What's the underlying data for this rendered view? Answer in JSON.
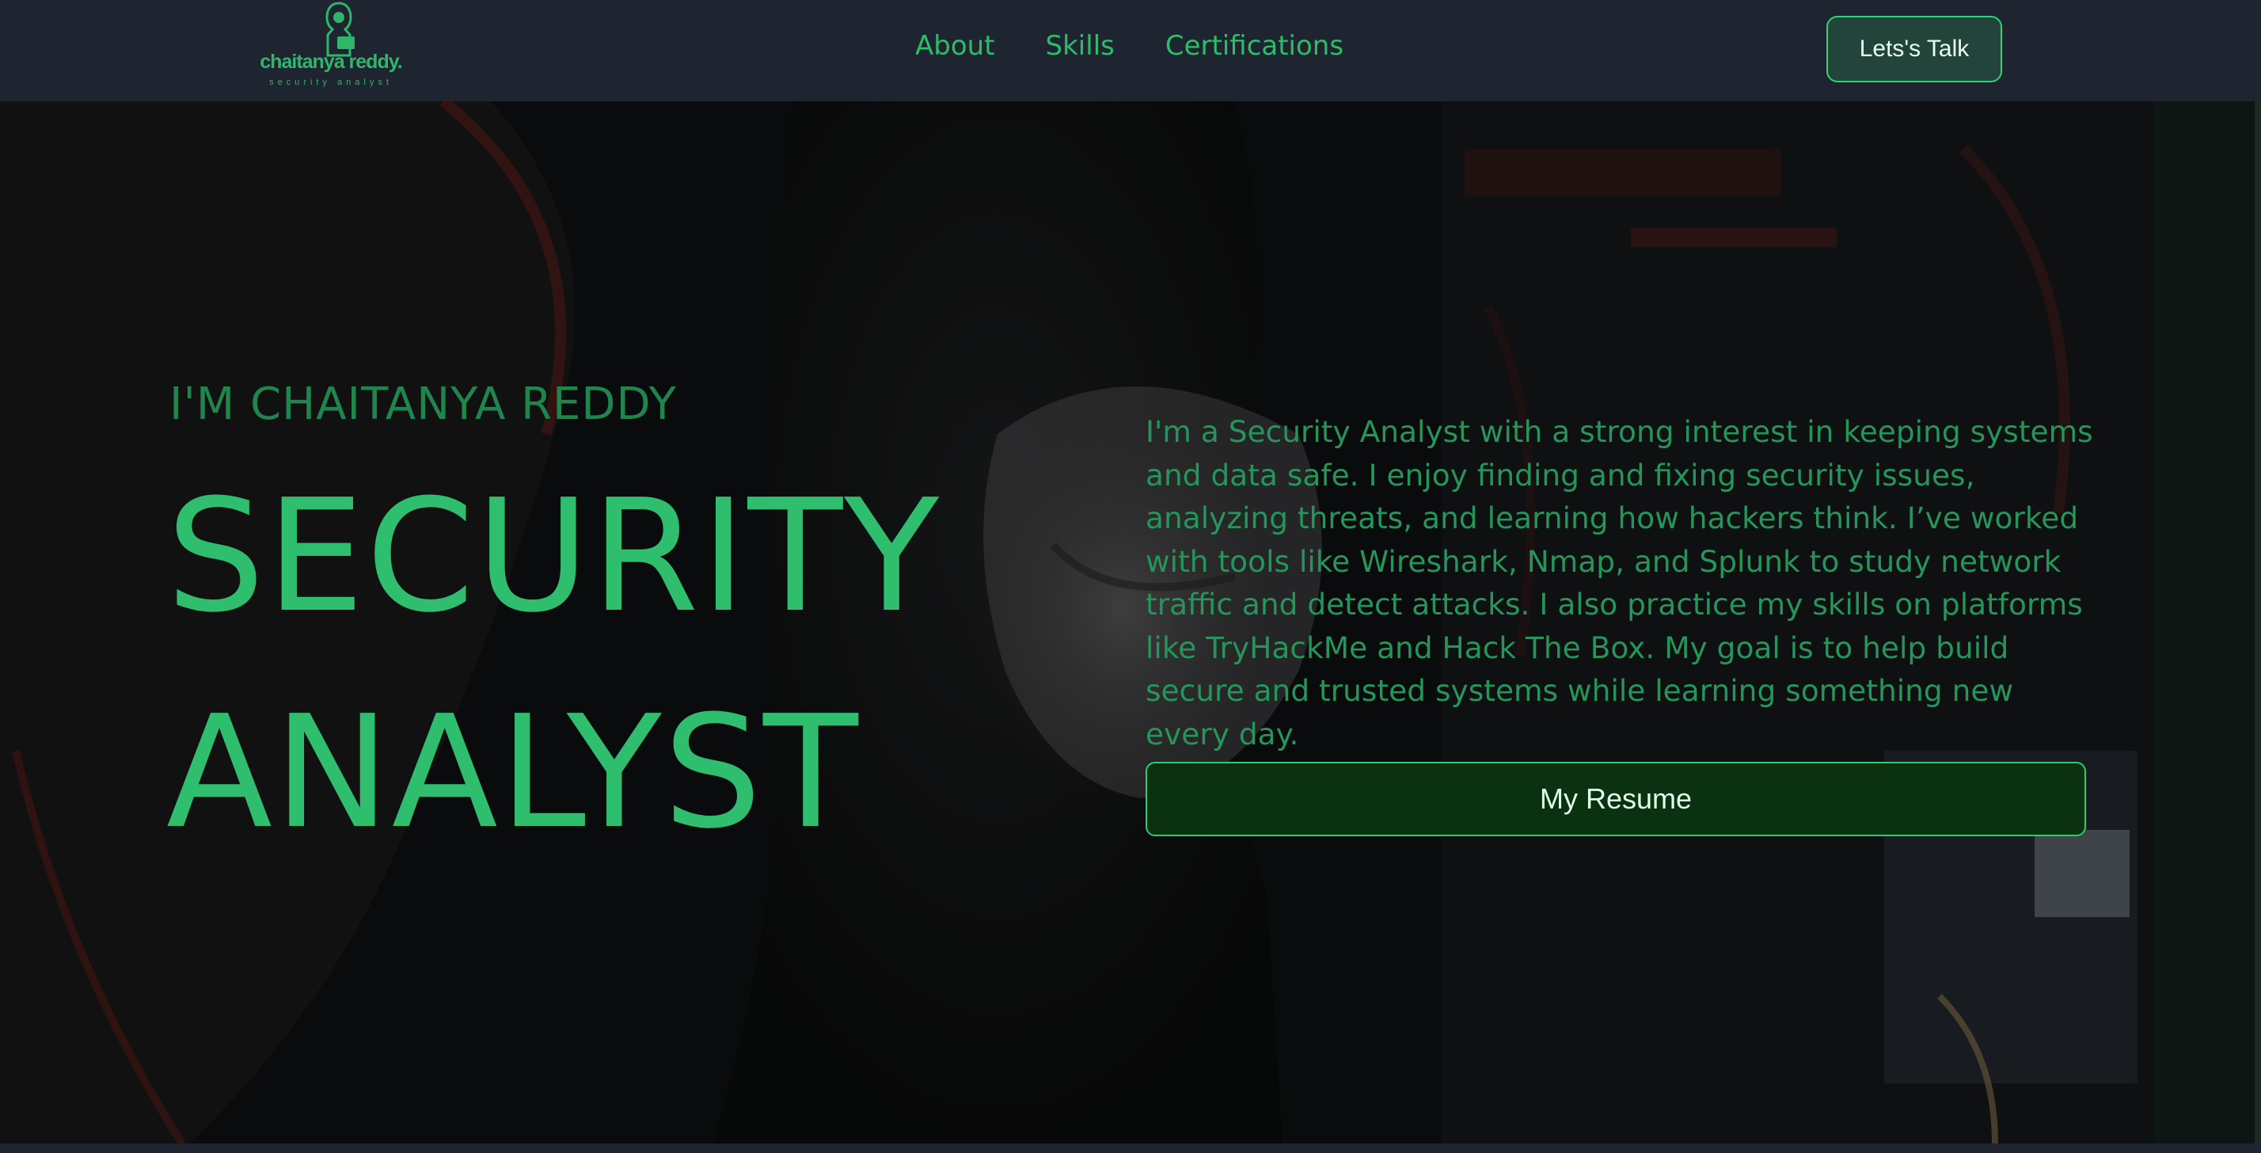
{
  "logo": {
    "name": "chaitanya reddy.",
    "tagline": "security analyst"
  },
  "nav": {
    "links": [
      "About",
      "Skills",
      "Certifications"
    ],
    "cta_label": "Lets's Talk"
  },
  "hero": {
    "intro": "I'M CHAITANYA REDDY",
    "title_line1": "SECURITY",
    "title_line2": "ANALYST",
    "bio": "I'm a Security Analyst with a strong interest in keeping systems and data safe. I enjoy finding and fixing security issues, analyzing threats, and learning how hackers think. I’ve worked with tools like Wireshark, Nmap, and Splunk to study network traffic and detect attacks. I also practice my skills on platforms like TryHackMe and Hack The Box. My goal is to help build secure and trusted systems while learning something new every day.",
    "resume_label": "My Resume"
  },
  "colors": {
    "accent": "#2fbd6e",
    "nav_bg": "#1f2431",
    "hero_bg": "#0a0b0c"
  },
  "icons": {
    "logo_figure": "hooded-hacker-with-laptop-icon"
  }
}
